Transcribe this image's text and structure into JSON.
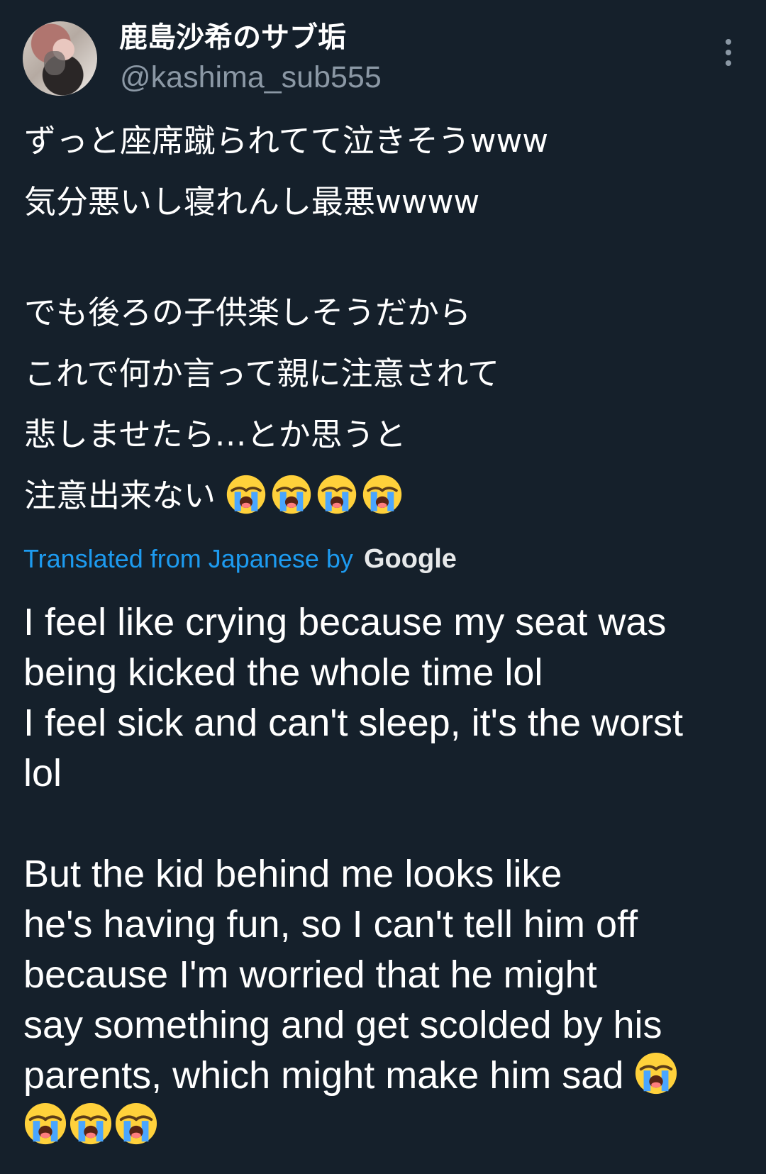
{
  "tweet": {
    "author": {
      "display_name": "鹿島沙希のサブ垢",
      "handle": "@kashima_sub555"
    },
    "original_text": {
      "lines": [
        "ずっと座席蹴られてて泣きそうwww",
        "気分悪いし寝れんし最悪wwww",
        "",
        "でも後ろの子供楽しそうだから",
        "これで何か言って親に注意されて",
        "悲しませたら…とか思うと",
        "注意出来ない"
      ],
      "trailing_emojis": [
        "crying-face",
        "crying-face",
        "crying-face",
        "crying-face"
      ]
    },
    "translation_notice": {
      "label": "Translated from Japanese by",
      "provider": "Google"
    },
    "translated_text": {
      "lines": [
        "I feel like crying because my seat was",
        "being kicked the whole time lol",
        "I feel sick and can't sleep, it's the worst",
        "lol",
        "",
        "But the kid behind me looks like",
        "he's having fun, so I can't tell him off",
        "because I'm worried that he might",
        "say something and get scolded by his",
        "parents, which might make him sad",
        ""
      ],
      "inline_emoji_after_line_10": "crying-face",
      "final_line_emojis": [
        "crying-face",
        "crying-face",
        "crying-face"
      ]
    },
    "icons": {
      "more": "more-vertical-icon",
      "emoji": "loudly-crying-face-icon"
    },
    "colors": {
      "background": "#15202b",
      "text": "#ffffff",
      "secondary": "#8b98a5",
      "link": "#1d9bf0"
    }
  }
}
